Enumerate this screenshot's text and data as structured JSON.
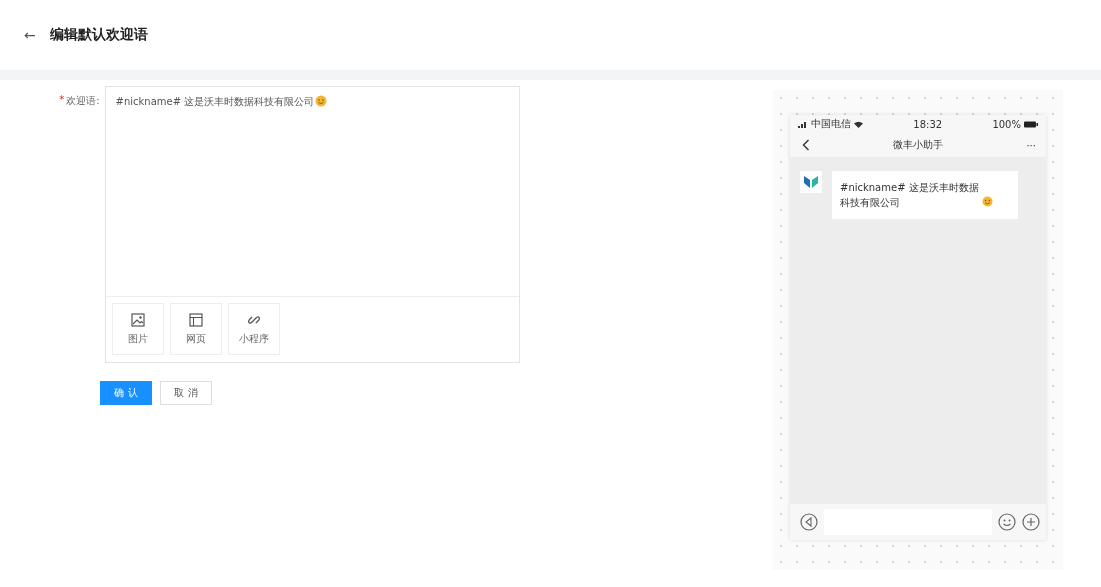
{
  "header": {
    "back": "←",
    "title": "编辑默认欢迎语"
  },
  "form": {
    "required_mark": "*",
    "label": "欢迎语:",
    "message": "#nickname# 这是沃丰时数据科技有限公司",
    "attachments": [
      {
        "kind": "image",
        "label": "图片"
      },
      {
        "kind": "web",
        "label": "网页"
      },
      {
        "kind": "miniapp",
        "label": "小程序"
      }
    ],
    "buttons": [
      {
        "label": "确 认",
        "primary": true
      },
      {
        "label": "取 消",
        "primary": false
      }
    ]
  },
  "phone": {
    "carrier": "中国电信",
    "time": "18:32",
    "battery": "100%",
    "title": "微丰小助手",
    "more": "···",
    "message": "#nickname# 这是沃丰时数据科技有限公司"
  }
}
